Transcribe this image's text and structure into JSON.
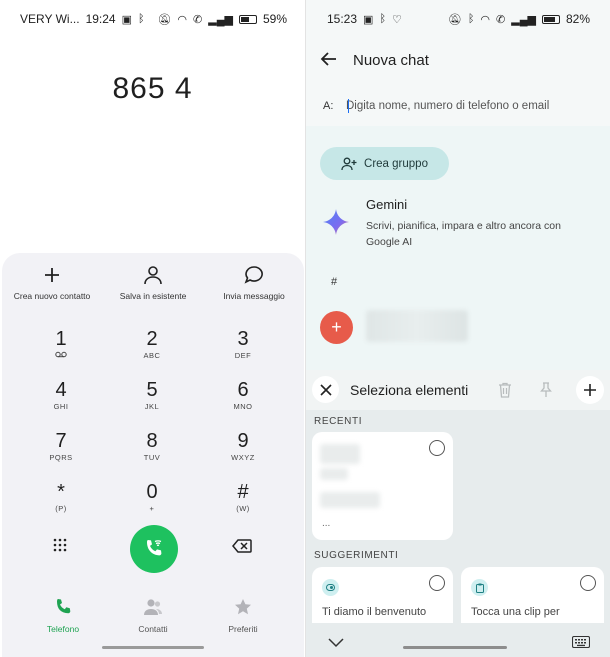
{
  "left": {
    "status": {
      "carrier": "VERY Wi...",
      "time": "19:24",
      "battery": "59%",
      "battery_level": 0.59
    },
    "dialer": {
      "number": "865 4"
    },
    "actions": [
      {
        "label": "Crea nuovo contatto",
        "icon": "plus-icon"
      },
      {
        "label": "Salva in esistente",
        "icon": "person-icon"
      },
      {
        "label": "Invia messaggio",
        "icon": "message-icon"
      }
    ],
    "keys": [
      {
        "digit": "1",
        "sub": "oo"
      },
      {
        "digit": "2",
        "sub": "ABC"
      },
      {
        "digit": "3",
        "sub": "DEF"
      },
      {
        "digit": "4",
        "sub": "GHI"
      },
      {
        "digit": "5",
        "sub": "JKL"
      },
      {
        "digit": "6",
        "sub": "MNO"
      },
      {
        "digit": "7",
        "sub": "PQRS"
      },
      {
        "digit": "8",
        "sub": "TUV"
      },
      {
        "digit": "9",
        "sub": "WXYZ"
      },
      {
        "digit": "*",
        "sub": "(P)"
      },
      {
        "digit": "0",
        "sub": "+"
      },
      {
        "digit": "#",
        "sub": "(W)"
      }
    ],
    "tabs": [
      {
        "label": "Telefono",
        "icon": "phone-icon",
        "active": true
      },
      {
        "label": "Contatti",
        "icon": "contacts-icon",
        "active": false
      },
      {
        "label": "Preferiti",
        "icon": "star-icon",
        "active": false
      }
    ],
    "colors": {
      "call": "#1ec15f",
      "active_tab": "#1fa352"
    }
  },
  "right": {
    "status": {
      "time": "15:23",
      "battery": "82%",
      "battery_level": 0.82
    },
    "header": {
      "title": "Nuova chat"
    },
    "to": {
      "label": "A:",
      "placeholder": "Digita nome, numero di telefono o email"
    },
    "create_group": "Crea gruppo",
    "gemini": {
      "name": "Gemini",
      "description": "Scrivi, pianifica, impara e altro ancora con Google AI"
    },
    "section_hash": "#",
    "contact_avatar": "+",
    "clipboard": {
      "title": "Seleziona elementi",
      "recent_label": "RECENTI",
      "recent_more": "...",
      "suggestions_label": "SUGGERIMENTI",
      "suggestions": [
        {
          "text": "Ti diamo il benvenuto",
          "icon": "toggle-icon"
        },
        {
          "text": "Tocca una clip per",
          "icon": "clipboard-icon"
        }
      ]
    },
    "colors": {
      "group_button": "#c6e7e7",
      "avatar": "#e75b4a"
    }
  }
}
